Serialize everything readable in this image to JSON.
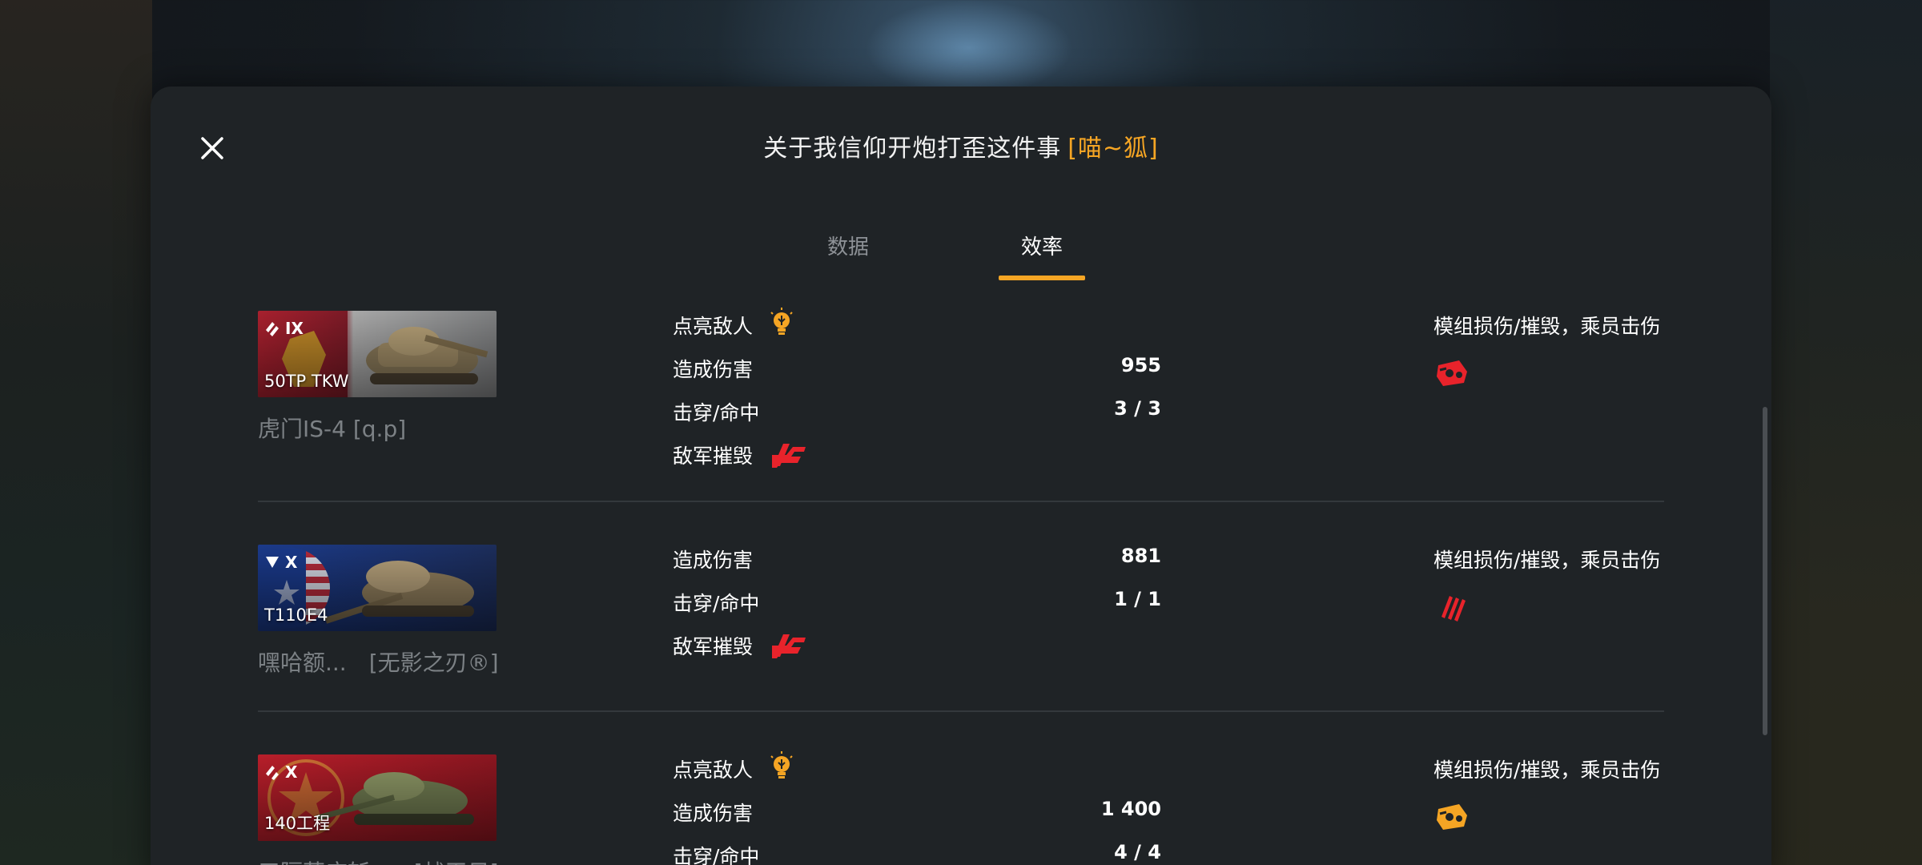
{
  "modal": {
    "title": "关于我信仰开炮打歪这件事",
    "clan_tag": "[喵~狐]"
  },
  "tabs": [
    {
      "label": "数据",
      "active": false
    },
    {
      "label": "效率",
      "active": true
    }
  ],
  "colors": {
    "accent": "#f5a524",
    "destroyed_red": "#e8232b",
    "module_red": "#e8232b",
    "module_orange": "#f5a524"
  },
  "rows": [
    {
      "tier": "IX",
      "tank": "50TP TKW",
      "nation_flag": "poland",
      "player": "虎门IS-4 [q.p]",
      "stats": [
        {
          "label": "点亮敌人",
          "icon": "lightbulb-icon"
        },
        {
          "label": "造成伤害",
          "value": "955"
        },
        {
          "label": "击穿/命中",
          "value": "3 / 3"
        },
        {
          "label": "敌军摧毁",
          "icon": "destroyed-tank-icon"
        }
      ],
      "module_label": "模组损伤/摧毁，乘员击伤",
      "module_icon": "damaged-track-icon",
      "module_icon_color": "red"
    },
    {
      "tier": "X",
      "tank": "T110E4",
      "nation_flag": "usa",
      "player": "嘿哈额...　[无影之刃®]",
      "stats": [
        {
          "label": "造成伤害",
          "value": "881"
        },
        {
          "label": "击穿/命中",
          "value": "1 / 1"
        },
        {
          "label": "敌军摧毁",
          "icon": "destroyed-tank-icon"
        }
      ],
      "module_label": "模组损伤/摧毁，乘员击伤",
      "module_icon": "crew-injured-icon",
      "module_icon_color": "red"
    },
    {
      "tier": "X",
      "tank": "140工程",
      "nation_flag": "ussr",
      "player": "三隔草庄斩...　[战天日]",
      "stats": [
        {
          "label": "点亮敌人",
          "icon": "lightbulb-icon"
        },
        {
          "label": "造成伤害",
          "value": "1 400"
        },
        {
          "label": "击穿/命中",
          "value": "4 / 4"
        }
      ],
      "module_label": "模组损伤/摧毁，乘员击伤",
      "module_icon": "damaged-track-icon",
      "module_icon_color": "orange"
    }
  ]
}
